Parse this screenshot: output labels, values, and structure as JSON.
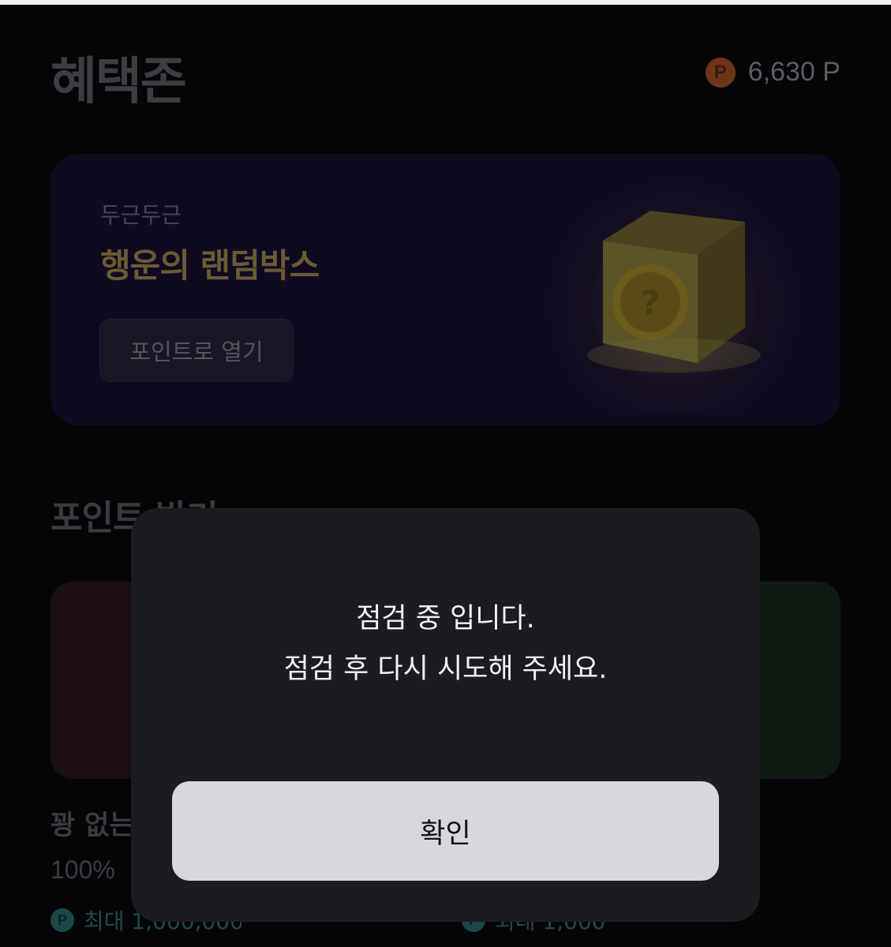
{
  "header": {
    "title": "혜택존",
    "points_icon": "P",
    "points_value": "6,630 P"
  },
  "banner": {
    "subtitle": "두근두근",
    "title": "행운의 랜덤박스",
    "button_label": "포인트로 열기",
    "image_icon": "random-box-icon"
  },
  "section": {
    "title": "포인트 받기"
  },
  "items": [
    {
      "title": "꽝 없는",
      "rate": "100%",
      "icon": "P",
      "max_label": "최대 1,000,000"
    },
    {
      "icon": "P",
      "max_label": "최대 1,000"
    }
  ],
  "modal": {
    "message_line1": "점검 중 입니다.",
    "message_line2": "점검 후 다시 시도해 주세요.",
    "confirm_label": "확인"
  },
  "colors": {
    "background": "#050507",
    "modal_background": "#1c1b21",
    "confirm_button": "#d8d7dc",
    "points_accent": "#6e3418"
  }
}
